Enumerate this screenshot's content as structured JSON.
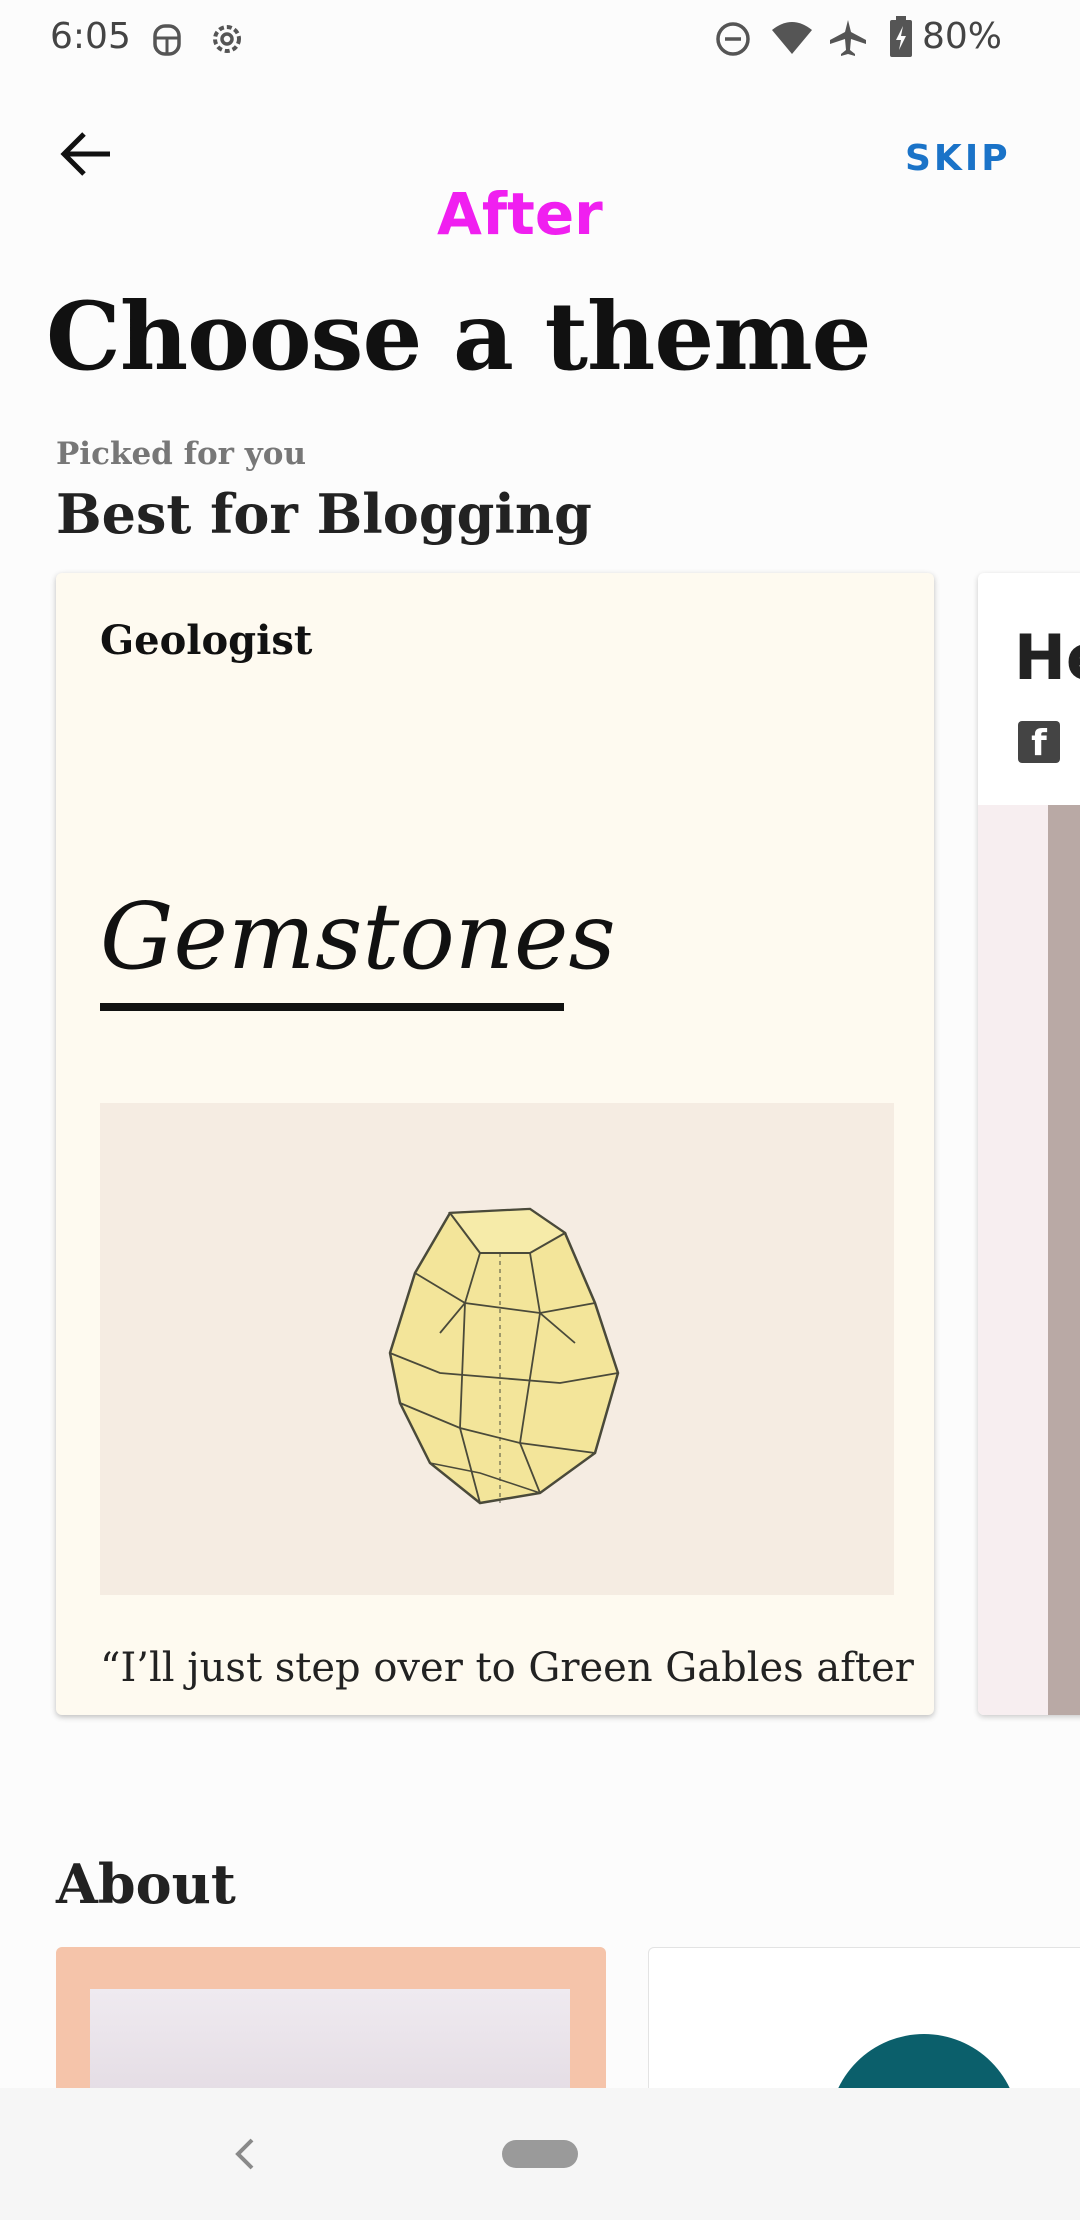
{
  "status_bar": {
    "time": "6:05",
    "battery_percent": "80%",
    "icons": [
      "android-debug-icon",
      "settings-icon",
      "do-not-disturb-icon",
      "wifi-icon",
      "airplane-mode-icon",
      "battery-icon"
    ]
  },
  "header": {
    "back_icon": "arrow-left-icon",
    "skip_label": "SKIP",
    "overlay_label": "After"
  },
  "page": {
    "title": "Choose a theme"
  },
  "section_blogging": {
    "subtitle": "Picked for you",
    "title": "Best for Blogging",
    "cards": [
      {
        "site_name": "Geologist",
        "heading": "Gemstones",
        "quote": "“I’ll just step over to Green Gables after"
      },
      {
        "title_partial": "He",
        "icon": "facebook-icon"
      }
    ]
  },
  "section_about": {
    "title": "About"
  },
  "nav_bar": {
    "icons": [
      "nav-back-icon",
      "nav-home-pill"
    ]
  },
  "colors": {
    "accent": "#1a73c8",
    "overlay": "#f01ff0",
    "card_bg": "#fefaf0",
    "gem": "#f3e59a"
  }
}
